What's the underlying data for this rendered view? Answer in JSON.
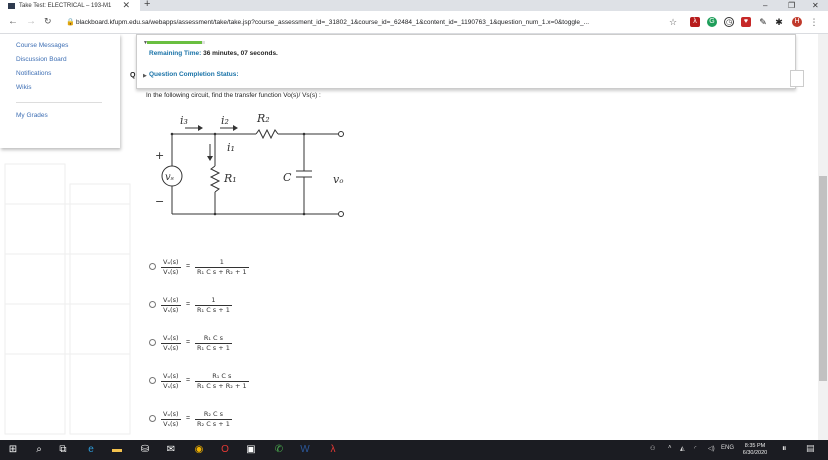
{
  "browser": {
    "tab_title": "Take Test: ELECTRICAL – 193-M1",
    "tab_close": "✕",
    "new_tab": "+",
    "url": "blackboard.kfupm.edu.sa/webapps/assessment/take/take.jsp?course_assessment_id=_31802_1&course_id=_62484_1&content_id=_1190763_1&question_num_1.x=0&toggle_...",
    "window_minimize": "–",
    "window_restore": "❐",
    "window_close": "✕",
    "profile_initial": "H"
  },
  "sidebar": {
    "items": [
      {
        "label": "Course Messages"
      },
      {
        "label": "Discussion Board"
      },
      {
        "label": "Notifications"
      },
      {
        "label": "Wikis"
      },
      {
        "label": "My Grades"
      }
    ]
  },
  "timer": {
    "remaining_label": "Remaining Time:",
    "remaining_value": "36 minutes, 07 seconds.",
    "completion_label": "Question Completion Status:",
    "progress_fraction": 0.95
  },
  "question": {
    "letter": "Q",
    "text": "In the following circuit, find the transfer function Vo(s)/ Vs(s) :",
    "circuit_labels": {
      "i3": "i₃",
      "i2": "i₂",
      "r2": "R₂",
      "i1": "i₁",
      "r1": "R₁",
      "vs": "vₛ",
      "plus": "+",
      "minus": "−",
      "c": "C",
      "vo": "vₒ"
    },
    "options": [
      {
        "lhs_num": "Vₒ(s)",
        "lhs_den": "Vₛ(s)",
        "rhs_num": "1",
        "rhs_den": "R₁ C s + R₂ + 1"
      },
      {
        "lhs_num": "Vₒ(s)",
        "lhs_den": "Vₛ(s)",
        "rhs_num": "1",
        "rhs_den": "R₁ C s + 1"
      },
      {
        "lhs_num": "Vₒ(s)",
        "lhs_den": "Vₛ(s)",
        "rhs_num": "R₁ C s",
        "rhs_den": "R₁ C s + 1"
      },
      {
        "lhs_num": "Vₒ(s)",
        "lhs_den": "Vₛ(s)",
        "rhs_num": "R₁ C s",
        "rhs_den": "R₁ C s + R₂ + 1"
      },
      {
        "lhs_num": "Vₒ(s)",
        "lhs_den": "Vₛ(s)",
        "rhs_num": "R₂ C s",
        "rhs_den": "R₂ C s + 1"
      }
    ],
    "equals": "="
  },
  "taskbar": {
    "time": "8:35 PM",
    "date": "6/30/2020",
    "language": "ENG"
  },
  "colors": {
    "link": "#3e6fb4",
    "label": "#1a73a8",
    "progress": "#6abf40",
    "taskbar": "#1b1c22"
  }
}
